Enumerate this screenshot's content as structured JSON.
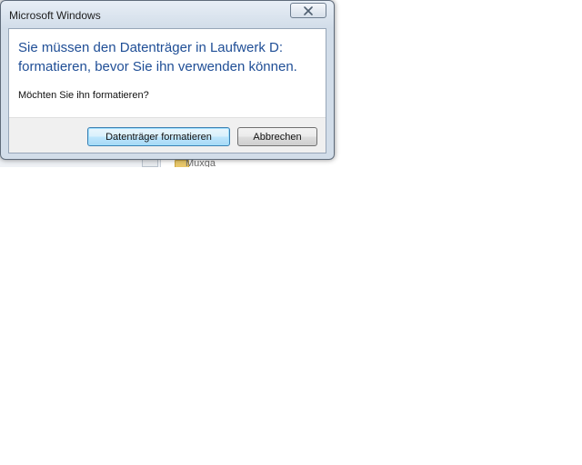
{
  "dialog": {
    "title": "Microsoft Windows",
    "main_instruction": {
      "line1": "Sie müssen den Datenträger in Laufwerk D:",
      "line2": "formatieren, bevor Sie ihn verwenden können."
    },
    "content_text": "Möchten Sie ihn formatieren?",
    "buttons": {
      "primary_label": "Datenträger formatieren",
      "cancel_label": "Abbrechen"
    },
    "close_icon": "close-icon",
    "colors": {
      "instruction_text": "#1f4e96",
      "primary_button_border": "#3c7fb1",
      "frame": "#d2dde9"
    }
  },
  "background": {
    "folder_label": "Muxga"
  }
}
